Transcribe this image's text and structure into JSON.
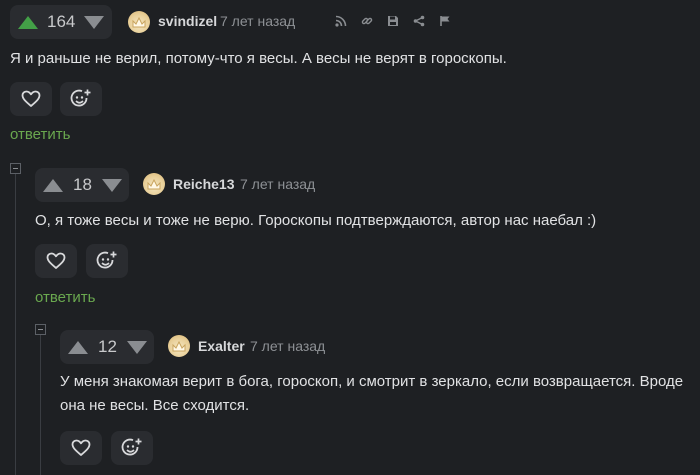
{
  "comments": [
    {
      "votes": "164",
      "username": "svindizel",
      "time": "7 лет назад",
      "text": "Я и раньше не верил, потому-что я весы. А весы не верят в гороскопы.",
      "reply_label": "ответить"
    },
    {
      "votes": "18",
      "username": "Reiche13",
      "time": "7 лет назад",
      "text": "О, я тоже весы и тоже не верю. Гороскопы подтверждаются, автор нас наебал :)",
      "reply_label": "ответить"
    },
    {
      "votes": "12",
      "username": "Exalter",
      "time": "7 лет назад",
      "text_line1": "У меня знакомая верит в бога, гороскоп, и смотрит в зеркало, если возвращается. Вроде",
      "text_line2": "она не весы. Все сходится."
    }
  ],
  "colors": {
    "background": "#1e2023",
    "upvote_active": "#43a047",
    "reply_link": "#6aa84f"
  },
  "icons": [
    "arrow-up-icon",
    "arrow-down-icon",
    "rss-icon",
    "link-icon",
    "save-icon",
    "share-icon",
    "flag-icon",
    "heart-icon",
    "smiley-add-icon",
    "collapse-minus-icon"
  ]
}
